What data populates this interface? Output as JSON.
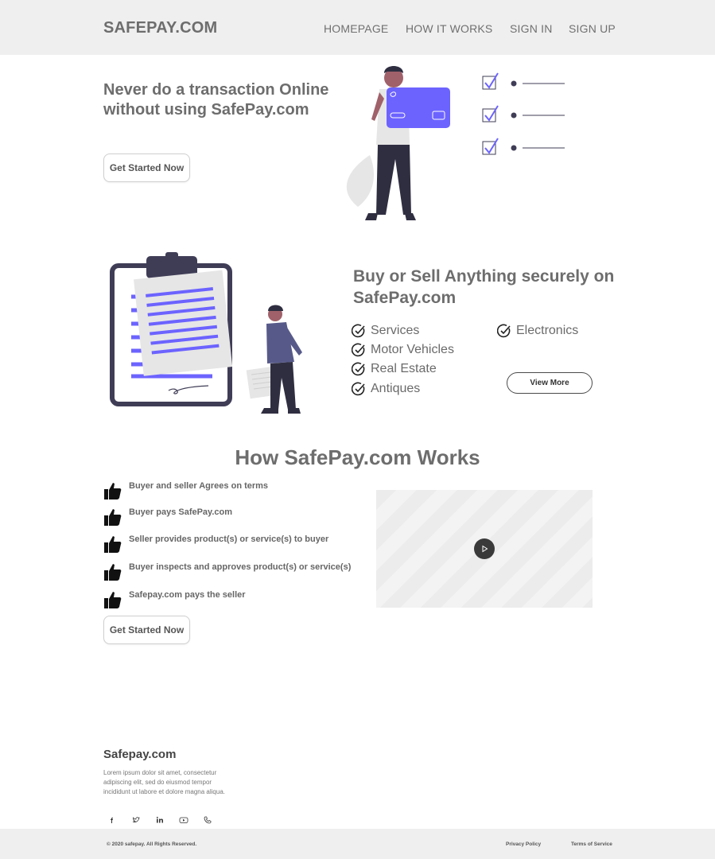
{
  "header": {
    "brand": "SAFEPAY.COM",
    "nav": [
      "HOMEPAGE",
      "HOW IT WORKS",
      "SIGN IN",
      "SIGN UP"
    ]
  },
  "hero": {
    "title": "Never do a transaction Online without using SafePay.com",
    "cta": "Get Started Now"
  },
  "categories_section": {
    "title": "Buy or Sell Anything securely on SafePay.com",
    "left_items": [
      "Services",
      "Motor Vehicles",
      "Real Estate",
      "Antiques"
    ],
    "right_items": [
      "Electronics"
    ],
    "view_more": "View More"
  },
  "how_it_works": {
    "title": "How SafePay.com Works",
    "steps": [
      "Buyer and seller Agrees on terms",
      "Buyer pays SafePay.com",
      "Seller provides product(s) or service(s) to buyer",
      "Buyer inspects and approves product(s) or service(s)",
      "Safepay.com pays the seller"
    ],
    "cta": "Get Started Now"
  },
  "footer": {
    "brand": "Safepay.com",
    "description": "Lorem ipsum dolor sit amet, consectetur adipiscing elit, sed do eiusmod tempor incididunt ut labore et dolore magna aliqua.",
    "social_icons": [
      "facebook-icon",
      "twitter-icon",
      "linkedin-icon",
      "youtube-icon",
      "phone-icon"
    ],
    "copyright": "© 2020 safepay.  All Rights Reserved.",
    "links": [
      "Privacy Policy",
      "Terms of Service"
    ]
  },
  "colors": {
    "accent": "#6c63ff",
    "dark": "#3f3d56",
    "header_bg": "#efefef",
    "text": "#6d6d6d"
  }
}
